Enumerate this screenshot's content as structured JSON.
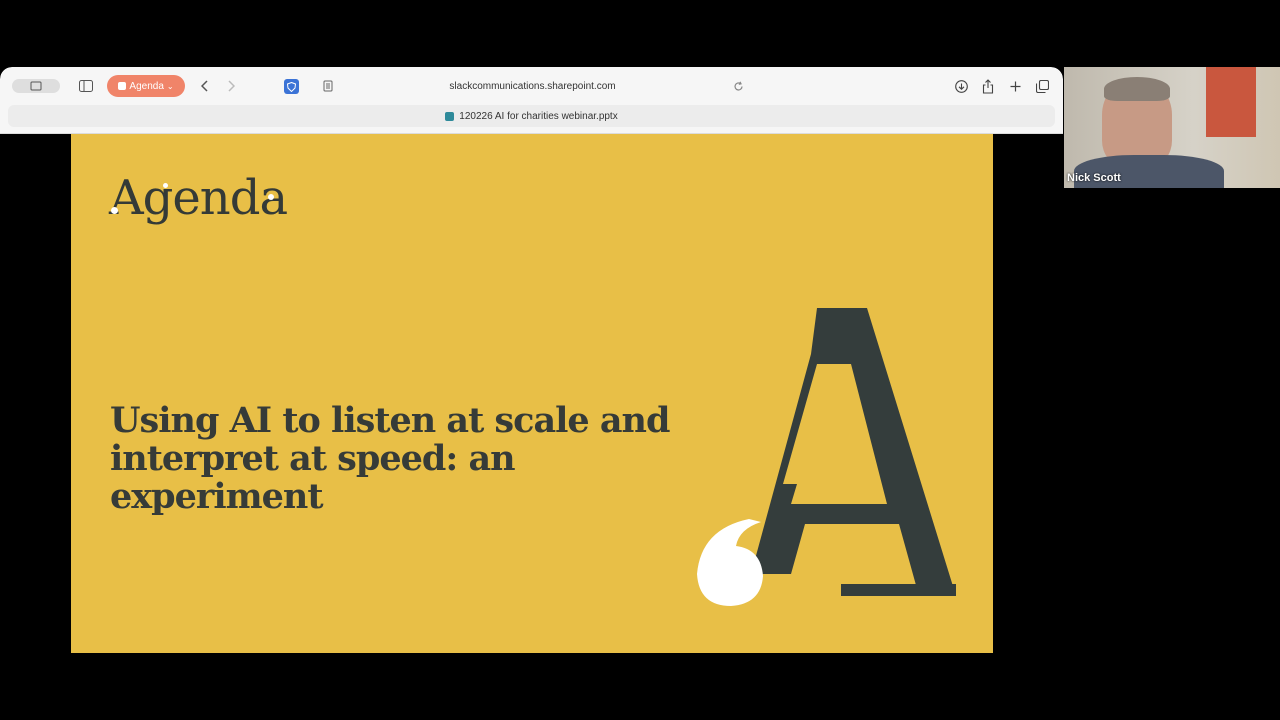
{
  "browser": {
    "tab_group": "Agenda",
    "url": "slackcommunications.sharepoint.com",
    "tab_title": "120226 AI for charities webinar.pptx",
    "icons": [
      "sidebar-icon",
      "back-icon",
      "forward-icon",
      "shield-icon",
      "reader-icon",
      "reload-icon",
      "download-icon",
      "share-icon",
      "new-tab-icon",
      "tabs-overview-icon"
    ]
  },
  "slide": {
    "title": "Agenda",
    "headline": "Using AI to listen at scale and interpret at speed: an experiment",
    "big_letter": "A",
    "background": "#e8bf47",
    "text_color": "#363b38"
  },
  "participant": {
    "name": "Nick Scott"
  }
}
